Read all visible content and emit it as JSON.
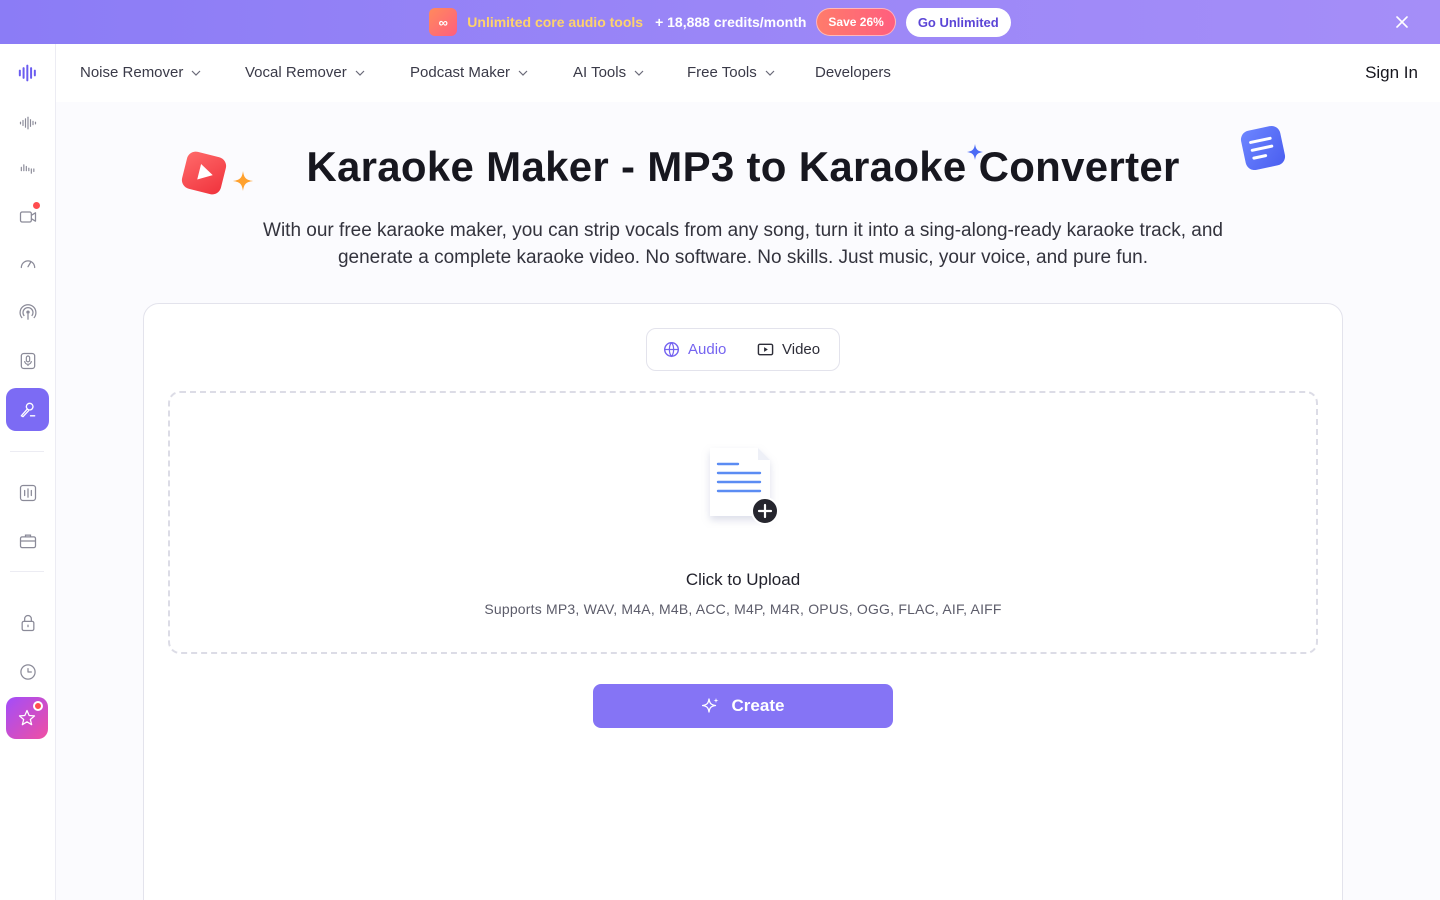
{
  "promo": {
    "icon": "infinity-icon",
    "text": "Unlimited core audio tools",
    "credits": "+ 18,888 credits/month",
    "save_badge": "Save 26%",
    "cta": "Go Unlimited",
    "close_icon": "close-icon"
  },
  "rail": {
    "items": [
      "logo-icon",
      "noise-wave-icon",
      "vocal-wave-icon",
      "video-record-icon",
      "speed-icon",
      "podcast-icon",
      "mic-icon",
      "karaoke-icon",
      "equalizer-icon",
      "toolbox-icon",
      "lock-icon",
      "clock-icon",
      "star-pro-icon"
    ]
  },
  "nav": {
    "items": [
      {
        "label": "Noise Remover"
      },
      {
        "label": "Vocal Remover"
      },
      {
        "label": "Podcast Maker"
      },
      {
        "label": "AI Tools"
      },
      {
        "label": "Free Tools"
      },
      {
        "label": "Developers"
      }
    ],
    "sign_in": "Sign In"
  },
  "hero": {
    "title": "Karaoke Maker - MP3 to Karaoke Converter",
    "subtitle": "With our free karaoke maker, you can strip vocals from any song, turn it into a sing-along-ready karaoke track, and generate a complete karaoke video. No software. No skills. Just music, your voice, and pure fun."
  },
  "tabs": {
    "audio": "Audio",
    "video": "Video",
    "selected": "Audio"
  },
  "upload": {
    "title": "Click to Upload",
    "supports": "Supports MP3, WAV, M4A, M4B, ACC, M4P, M4R, OPUS, OGG, FLAC, AIF, AIFF"
  },
  "create": {
    "label": "Create"
  },
  "colors": {
    "accent": "#7c6bf4",
    "banner": "#9a86f7",
    "highlight": "#ffd36b"
  }
}
